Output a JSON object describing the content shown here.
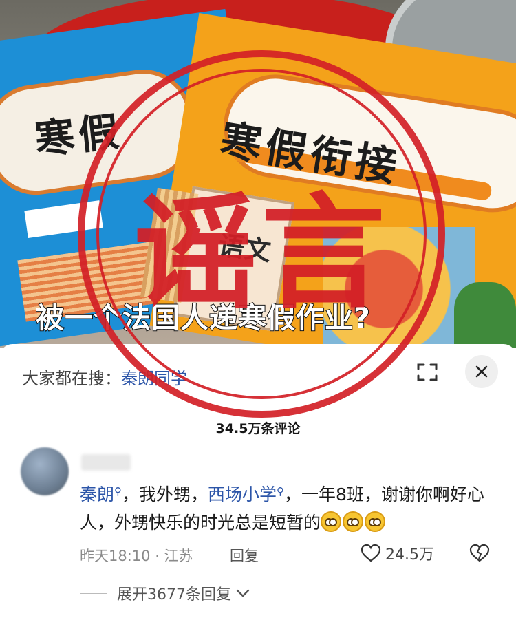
{
  "video": {
    "book_title_left": "寒假",
    "book_title_right": "寒假衔接",
    "subject_text": "语文",
    "caption": "被一个法国人递寒假作业?"
  },
  "stamp": {
    "text": "谣言",
    "color": "#d31f26"
  },
  "panel": {
    "search_prefix": "大家都在搜：",
    "search_keyword": "秦朗同学",
    "close_icon": "close-icon",
    "expand_icon": "expand-icon",
    "comment_count": "34.5万条评论"
  },
  "comment": {
    "mention_name": "秦朗",
    "text_1": "，我外甥，",
    "mention_school": "西场小学",
    "text_2": "，一年8班，谢谢你啊好心人，外甥快乐的时光总是短暂的",
    "emoji_icon": "grimace-emoji",
    "time": "昨天18:10 · 江苏",
    "reply_label": "回复",
    "like_count": "24.5万",
    "expand_label": "展开3677条回复"
  }
}
